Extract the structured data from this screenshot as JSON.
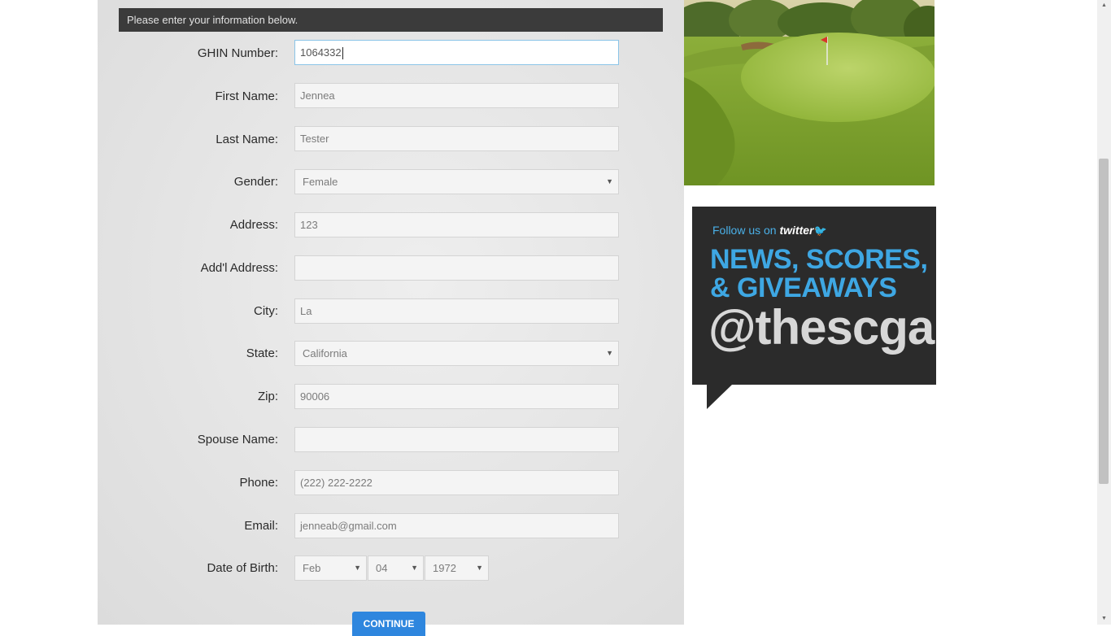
{
  "form": {
    "header": "Please enter your information below.",
    "fields": [
      {
        "label": "GHIN Number:",
        "value": "1064332"
      },
      {
        "label": "First Name:",
        "value": "Jennea"
      },
      {
        "label": "Last Name:",
        "value": "Tester"
      },
      {
        "label": "Gender:",
        "value": "Female"
      },
      {
        "label": "Address:",
        "value": "123"
      },
      {
        "label": "Add'l Address:",
        "value": ""
      },
      {
        "label": "City:",
        "value": "La"
      },
      {
        "label": "State:",
        "value": "California"
      },
      {
        "label": "Zip:",
        "value": "90006"
      },
      {
        "label": "Spouse Name:",
        "value": ""
      },
      {
        "label": "Phone:",
        "value": "(222) 222-2222"
      },
      {
        "label": "Email:",
        "value": "jenneab@gmail.com"
      }
    ],
    "dob": {
      "label": "Date of Birth:",
      "month": "Feb",
      "day": "04",
      "year": "1972"
    },
    "continue_label": "Continue"
  },
  "twitter": {
    "follow_text": "Follow us on",
    "twitter_word": "twitter",
    "headline_line1": "NEWS, SCORES,",
    "headline_line2": "& GIVEAWAYS",
    "handle": "@thescga"
  },
  "colors": {
    "header_bg": "#3b3b3b",
    "button": "#2e86de",
    "twitter_blue": "#3ea7e3",
    "panel_bg": "#e6e6e6"
  },
  "icons": {
    "dropdown": "chevron-down-icon",
    "bird": "twitter-bird-icon"
  }
}
